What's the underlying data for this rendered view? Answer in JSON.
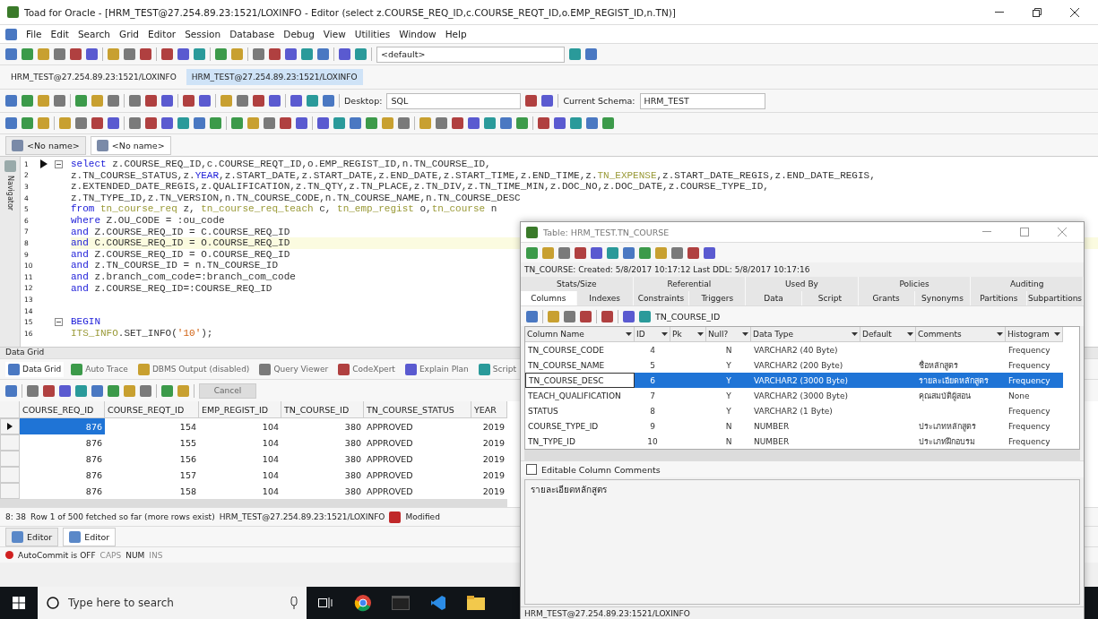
{
  "window": {
    "title": "Toad for Oracle - [HRM_TEST@27.254.89.23:1521/LOXINFO - Editor (select z.COURSE_REQ_ID,c.COURSE_REQT_ID,o.EMP_REGIST_ID,n.TN)]"
  },
  "menu": [
    "File",
    "Edit",
    "Search",
    "Grid",
    "Editor",
    "Session",
    "Database",
    "Debug",
    "View",
    "Utilities",
    "Window",
    "Help"
  ],
  "toolbar": {
    "combo": "<default>"
  },
  "connections": [
    {
      "label": "HRM_TEST@27.254.89.23:1521/LOXINFO",
      "selected": false
    },
    {
      "label": "HRM_TEST@27.254.89.23:1521/LOXINFO",
      "selected": true
    }
  ],
  "desktop": {
    "label": "Desktop:",
    "value": "SQL"
  },
  "schema": {
    "label": "Current Schema:",
    "value": "HRM_TEST"
  },
  "editor_tabs": [
    {
      "label": "<No name>",
      "selected": false
    },
    {
      "label": "<No name>",
      "selected": true
    }
  ],
  "navigator": "Navigator",
  "editor": {
    "lines": [
      {
        "number": "1",
        "arrow": true,
        "fold": true,
        "current": false,
        "tokens": [
          {
            "kind": "kw",
            "text": "select"
          },
          {
            "kind": "plain",
            "text": " z.COURSE_REQ_ID,c.COURSE_REQT_ID,o.EMP_REGIST_ID,n.TN_COURSE_ID,"
          }
        ]
      },
      {
        "number": "2",
        "arrow": false,
        "fold": false,
        "current": false,
        "tokens": [
          {
            "kind": "plain",
            "text": "z.TN_COURSE_STATUS,z."
          },
          {
            "kind": "kw",
            "text": "YEAR"
          },
          {
            "kind": "plain",
            "text": ",z.START_DATE,z.START_DATE,z.END_DATE,z.START_TIME,z.END_TIME,z."
          },
          {
            "kind": "name",
            "text": "TN_EXPENSE"
          },
          {
            "kind": "plain",
            "text": ",z.START_DATE_REGIS,z.END_DATE_REGIS,"
          }
        ]
      },
      {
        "number": "3",
        "arrow": false,
        "fold": false,
        "current": false,
        "tokens": [
          {
            "kind": "plain",
            "text": "z.EXTENDED_DATE_REGIS,z.QUALIFICATION,z.TN_QTY,z.TN_PLACE,z.TN_DIV,z.TN_TIME_MIN,z.DOC_NO,z.DOC_DATE,z.COURSE_TYPE_ID,"
          }
        ]
      },
      {
        "number": "4",
        "arrow": false,
        "fold": false,
        "current": false,
        "tokens": [
          {
            "kind": "plain",
            "text": "z.TN_TYPE_ID,z.TN_VERSION,n.TN_COURSE_CODE,n.TN_COURSE_NAME,n.TN_COURSE_DESC"
          }
        ]
      },
      {
        "number": "5",
        "arrow": false,
        "fold": false,
        "current": false,
        "tokens": [
          {
            "kind": "kw",
            "text": "from"
          },
          {
            "kind": "name",
            "text": " tn_course_req"
          },
          {
            "kind": "plain",
            "text": " z, "
          },
          {
            "kind": "name",
            "text": "tn_course_req_teach"
          },
          {
            "kind": "plain",
            "text": " c, "
          },
          {
            "kind": "name",
            "text": "tn_emp_regist"
          },
          {
            "kind": "plain",
            "text": " o,"
          },
          {
            "kind": "name",
            "text": "tn_course"
          },
          {
            "kind": "plain",
            "text": " n"
          }
        ]
      },
      {
        "number": "6",
        "arrow": false,
        "fold": false,
        "current": false,
        "tokens": [
          {
            "kind": "kw",
            "text": "where"
          },
          {
            "kind": "plain",
            "text": " Z.OU_CODE = :ou_code"
          }
        ]
      },
      {
        "number": "7",
        "arrow": false,
        "fold": false,
        "current": false,
        "tokens": [
          {
            "kind": "kw",
            "text": "and"
          },
          {
            "kind": "plain",
            "text": " Z.COURSE_REQ_ID = C.COURSE_REQ_ID"
          }
        ]
      },
      {
        "number": "8",
        "arrow": false,
        "fold": false,
        "current": true,
        "tokens": [
          {
            "kind": "kw",
            "text": "and"
          },
          {
            "kind": "plain",
            "text": " C.COURSE_REQ_ID = O.COURSE_REQ_ID"
          }
        ]
      },
      {
        "number": "9",
        "arrow": false,
        "fold": false,
        "current": false,
        "tokens": [
          {
            "kind": "kw",
            "text": "and"
          },
          {
            "kind": "plain",
            "text": " Z.COURSE_REQ_ID = O.COURSE_REQ_ID"
          }
        ]
      },
      {
        "number": "10",
        "arrow": false,
        "fold": false,
        "current": false,
        "tokens": [
          {
            "kind": "kw",
            "text": "and"
          },
          {
            "kind": "plain",
            "text": " z.TN_COURSE_ID = n.TN_COURSE_ID"
          }
        ]
      },
      {
        "number": "11",
        "arrow": false,
        "fold": false,
        "current": false,
        "tokens": [
          {
            "kind": "kw",
            "text": "and"
          },
          {
            "kind": "plain",
            "text": " z.branch_com_code=:branch_com_code"
          }
        ]
      },
      {
        "number": "12",
        "arrow": false,
        "fold": false,
        "current": false,
        "tokens": [
          {
            "kind": "kw",
            "text": "and"
          },
          {
            "kind": "plain",
            "text": " z.COURSE_REQ_ID=:COURSE_REQ_ID"
          }
        ]
      },
      {
        "number": "13",
        "arrow": false,
        "fold": false,
        "current": false
      },
      {
        "number": "14",
        "arrow": false,
        "fold": false,
        "current": false
      },
      {
        "number": "15",
        "arrow": false,
        "fold": true,
        "current": false,
        "tokens": [
          {
            "kind": "kw",
            "text": "BEGIN"
          }
        ]
      },
      {
        "number": "16",
        "arrow": false,
        "fold": false,
        "current": false,
        "tokens": [
          {
            "kind": "name",
            "text": "ITS_INFO"
          },
          {
            "kind": "plain",
            "text": ".SET_INFO("
          },
          {
            "kind": "string",
            "text": "'10'"
          },
          {
            "kind": "plain",
            "text": ");"
          }
        ]
      }
    ]
  },
  "data_grid": {
    "label": "Data Grid",
    "tabs": [
      {
        "label": "Data Grid",
        "selected": true
      },
      {
        "label": "Auto Trace",
        "selected": false
      },
      {
        "label": "DBMS Output (disabled)",
        "selected": false
      },
      {
        "label": "Query Viewer",
        "selected": false
      },
      {
        "label": "CodeXpert",
        "selected": false
      },
      {
        "label": "Explain Plan",
        "selected": false
      },
      {
        "label": "Script",
        "selected": false
      }
    ],
    "cancel": "Cancel",
    "columns": [
      {
        "label": "COURSE_REQ_ID",
        "kind": "number"
      },
      {
        "label": "COURSE_REQT_ID",
        "kind": "number"
      },
      {
        "label": "EMP_REGIST_ID",
        "kind": "number"
      },
      {
        "label": "TN_COURSE_ID",
        "kind": "number"
      },
      {
        "label": "TN_COURSE_STATUS",
        "kind": "text"
      },
      {
        "label": "YEAR",
        "kind": "number"
      }
    ],
    "rows": [
      {
        "selected": true,
        "cells": [
          "876",
          "154",
          "104",
          "380",
          "APPROVED",
          "2019"
        ]
      },
      {
        "selected": false,
        "cells": [
          "876",
          "155",
          "104",
          "380",
          "APPROVED",
          "2019"
        ]
      },
      {
        "selected": false,
        "cells": [
          "876",
          "156",
          "104",
          "380",
          "APPROVED",
          "2019"
        ]
      },
      {
        "selected": false,
        "cells": [
          "876",
          "157",
          "104",
          "380",
          "APPROVED",
          "2019"
        ]
      },
      {
        "selected": false,
        "cells": [
          "876",
          "158",
          "104",
          "380",
          "APPROVED",
          "2019"
        ]
      }
    ]
  },
  "status_bar": {
    "position": "8: 38",
    "rows_info": "Row 1 of 500 fetched so far (more rows exist)",
    "connection": "HRM_TEST@27.254.89.23:1521/LOXINFO",
    "modified": "Modified"
  },
  "bottom_tabs": [
    {
      "label": "Editor",
      "selected": false
    },
    {
      "label": "Editor",
      "selected": true
    }
  ],
  "autocommit": "AutoCommit is OFF",
  "indicators": [
    {
      "label": "CAPS",
      "on": false
    },
    {
      "label": "NUM",
      "on": true
    },
    {
      "label": "INS",
      "on": false
    }
  ],
  "taskbar": {
    "search_placeholder": "Type here to search"
  },
  "table_window": {
    "title": "Table: HRM_TEST.TN_COURSE",
    "info": "TN_COURSE:  Created: 5/8/2017 10:17:12  Last DDL: 5/8/2017 10:17:16",
    "tabs_top": [
      {
        "label": "Stats/Size",
        "selected": false
      },
      {
        "label": "Referential",
        "selected": false
      },
      {
        "label": "Used By",
        "selected": false
      },
      {
        "label": "Policies",
        "selected": false
      },
      {
        "label": "Auditing",
        "selected": false
      }
    ],
    "tabs": [
      {
        "label": "Columns",
        "selected": true
      },
      {
        "label": "Indexes",
        "selected": false
      },
      {
        "label": "Constraints",
        "selected": false
      },
      {
        "label": "Triggers",
        "selected": false
      },
      {
        "label": "Data",
        "selected": false
      },
      {
        "label": "Script",
        "selected": false
      },
      {
        "label": "Grants",
        "selected": false
      },
      {
        "label": "Synonyms",
        "selected": false
      },
      {
        "label": "Partitions",
        "selected": false
      },
      {
        "label": "Subpartitions",
        "selected": false
      }
    ],
    "filter_column": "TN_COURSE_ID",
    "columns": [
      "Column Name",
      "ID",
      "Pk",
      "Null?",
      "Data Type",
      "Default",
      "Comments",
      "Histogram"
    ],
    "rows": [
      {
        "selected": false,
        "name": "TN_COURSE_CODE",
        "id": "4",
        "null": "N",
        "type": "VARCHAR2 (40 Byte)",
        "histogram": "Frequency"
      },
      {
        "selected": false,
        "name": "TN_COURSE_NAME",
        "id": "5",
        "null": "Y",
        "type": "VARCHAR2 (200 Byte)",
        "comment": "ชื่อหลักสูตร",
        "histogram": "Frequency"
      },
      {
        "selected": true,
        "name": "TN_COURSE_DESC",
        "id": "6",
        "null": "Y",
        "type": "VARCHAR2 (3000 Byte)",
        "comment": "รายละเอียดหลักสูตร",
        "histogram": "Frequency"
      },
      {
        "selected": false,
        "name": "TEACH_QUALIFICATION",
        "id": "7",
        "null": "Y",
        "type": "VARCHAR2 (3000 Byte)",
        "comment": "คุณสมบัติผู้สอน",
        "histogram": "None"
      },
      {
        "selected": false,
        "name": "STATUS",
        "id": "8",
        "null": "Y",
        "type": "VARCHAR2 (1 Byte)",
        "histogram": "Frequency"
      },
      {
        "selected": false,
        "name": "COURSE_TYPE_ID",
        "id": "9",
        "null": "N",
        "type": "NUMBER",
        "comment": "ประเภทหลักสูตร",
        "histogram": "Frequency"
      },
      {
        "selected": false,
        "name": "TN_TYPE_ID",
        "id": "10",
        "null": "N",
        "type": "NUMBER",
        "comment": "ประเภทฝึกอบรม",
        "histogram": "Frequency"
      }
    ],
    "editable_comments": {
      "label": "Editable Column Comments",
      "checked": false
    },
    "comment_text": "รายละเอียดหลักสูตร",
    "status": "HRM_TEST@27.254.89.23:1521/LOXINFO"
  }
}
